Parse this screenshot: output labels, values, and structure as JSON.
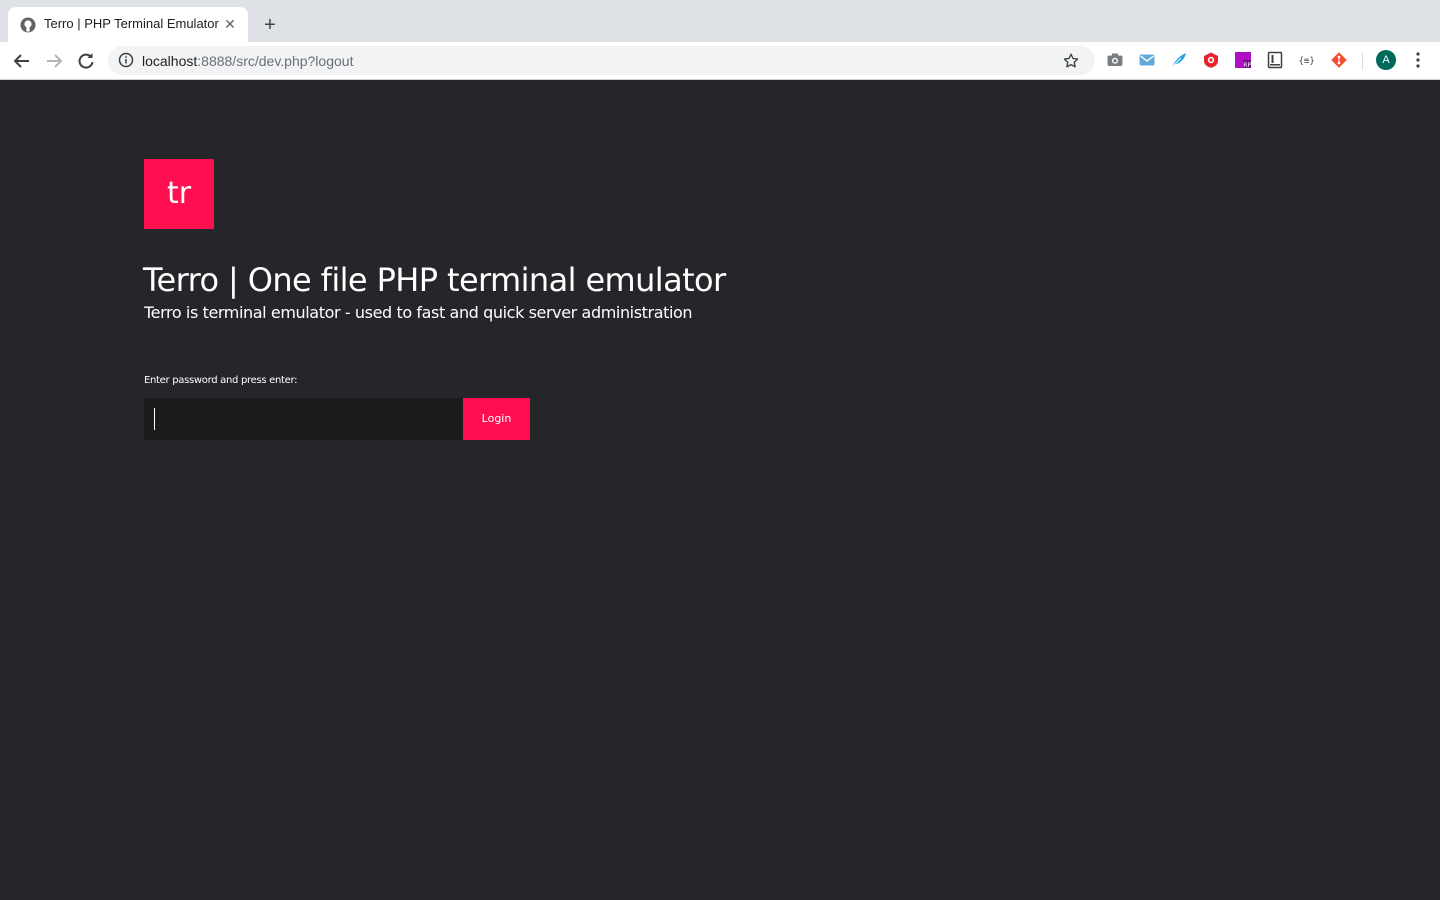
{
  "browser": {
    "tab": {
      "title": "Terro | PHP Terminal Emulator",
      "close": "✕"
    },
    "new_tab": "+",
    "address": {
      "host": "localhost",
      "rest": ":8888/src/dev.php?logout"
    },
    "profile_initial": "A",
    "icons": {
      "favicon": "github-icon",
      "back": "back-arrow-icon",
      "forward": "forward-arrow-icon",
      "reload": "reload-icon",
      "site_info": "info-icon",
      "bookmark": "star-icon",
      "extensions": [
        "camera-icon",
        "mail-icon",
        "feather-icon",
        "red-shield-icon",
        "rp-icon",
        "notebook-icon",
        "json-braces-icon",
        "git-icon"
      ],
      "menu": "kebab-menu-icon"
    }
  },
  "page": {
    "logo_text": "tr",
    "title": "Terro | One file PHP terminal emulator",
    "subtitle": "Terro is terminal emulator - used to fast and quick server administration",
    "password_label": "Enter password and press enter:",
    "password_value": "",
    "login_label": "Login"
  },
  "colors": {
    "background": "#252629",
    "accent": "#ff0f50",
    "input_background": "#1b1b1d",
    "text": "#ffffff"
  }
}
